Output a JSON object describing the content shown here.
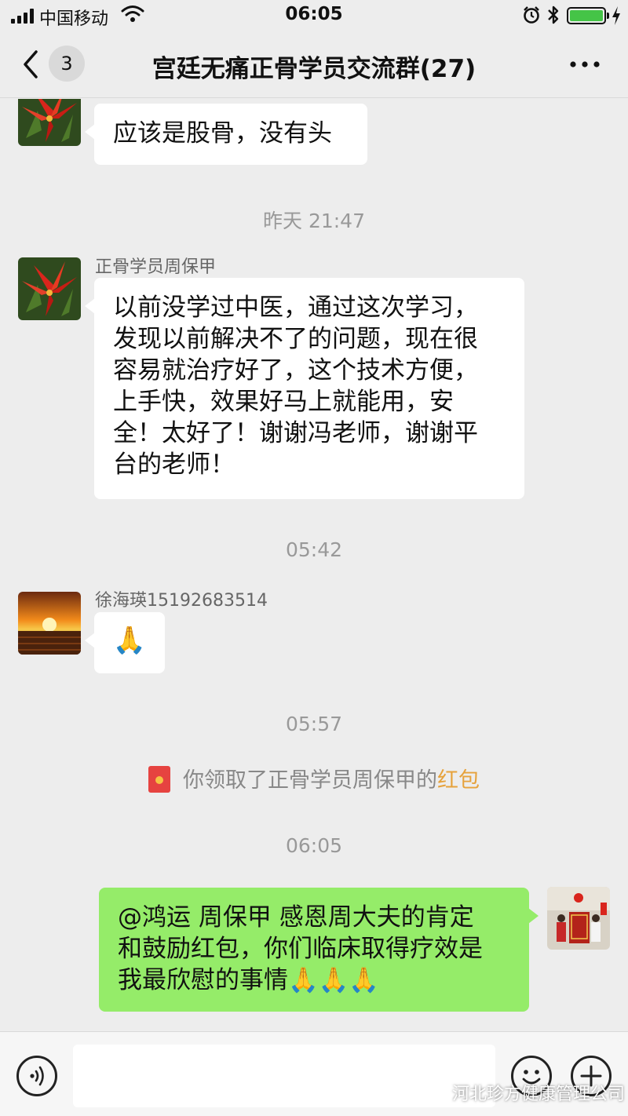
{
  "status_bar": {
    "carrier": "中国移动",
    "time": "06:05",
    "battery_level": 1.0,
    "battery_color": "#45c447"
  },
  "nav": {
    "back_icon": "chevron-left-icon",
    "unread_count": "3",
    "title": "宫廷无痛正骨学员交流群(27)",
    "more_icon": "more-dots-icon"
  },
  "messages": [
    {
      "type": "text",
      "side": "left",
      "avatar": "red-flower",
      "text": "应该是股骨，没有头"
    },
    {
      "type": "timestamp",
      "text": "昨天 21:47"
    },
    {
      "type": "text",
      "side": "left",
      "sender": "正骨学员周保甲",
      "avatar": "red-flower",
      "lines": [
        "以前没学过中医，通过这次学习，",
        "发现以前解决不了的问题，现在很",
        "容易就治疗好了，这个技术方便，",
        "上手快，效果好马上就能用，安",
        "全！太好了！谢谢冯老师，谢谢平",
        "台的老师！"
      ]
    },
    {
      "type": "timestamp",
      "text": "05:42"
    },
    {
      "type": "text",
      "side": "left",
      "sender": "徐海瑛15192683514",
      "avatar": "sunset",
      "text": "🙏"
    },
    {
      "type": "timestamp",
      "text": "05:57"
    },
    {
      "type": "system",
      "icon": "red-envelope-icon",
      "text": "你领取了正骨学员周保甲的",
      "link": "红包"
    },
    {
      "type": "timestamp",
      "text": "06:05"
    },
    {
      "type": "text",
      "side": "right",
      "avatar": "banner-photo",
      "lines": [
        "@鸿运 周保甲 感恩周大夫的肯定",
        "和鼓励红包，你们临床取得疗效是",
        "我最欣慰的事情🙏🙏🙏"
      ]
    }
  ],
  "input_bar": {
    "voice_icon": "voice-icon",
    "emoji_icon": "emoji-icon",
    "plus_icon": "plus-icon",
    "input_value": "",
    "input_placeholder": ""
  },
  "watermark": {
    "text": "河北珍方健康管理公司"
  },
  "colors": {
    "background": "#ededed",
    "bubble_self": "#95ec69",
    "bubble_other": "#ffffff",
    "red_packet_link": "#e6a23c"
  }
}
